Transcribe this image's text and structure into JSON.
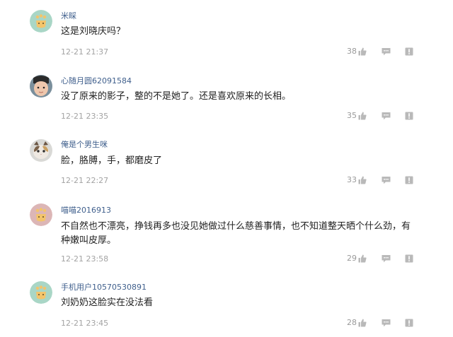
{
  "comments": [
    {
      "username": "米睬",
      "text": "这是刘晓庆吗？",
      "time": "12-21 21:37",
      "likes": "38",
      "avatar_icon": "default-user-avatar-icon"
    },
    {
      "username": "心随月圆62091584",
      "text": "没了原来的影子，整的不是她了。还是喜欢原来的长相。",
      "time": "12-21 23:35",
      "likes": "35",
      "avatar_icon": "child-photo-avatar-icon"
    },
    {
      "username": "俺是个男生咪",
      "text": "脸，胳膊，手，都磨皮了",
      "time": "12-21 22:27",
      "likes": "33",
      "avatar_icon": "kitten-photo-avatar-icon"
    },
    {
      "username": "喵喵2016913",
      "text": "不自然也不漂亮，挣钱再多也没见她做过什么慈善事情，也不知道整天晒个什么劲，有种嫩叫皮厚。",
      "time": "12-21 23:58",
      "likes": "29",
      "avatar_icon": "default-user-avatar-pink-icon"
    },
    {
      "username": "手机用户10570530891",
      "text": "刘奶奶这脸实在没法看",
      "time": "12-21 23:45",
      "likes": "28",
      "avatar_icon": "default-user-avatar-icon"
    }
  ],
  "icons": {
    "like": "thumbs-up-icon",
    "reply": "reply-bubble-icon",
    "report": "report-flag-icon"
  },
  "colors": {
    "username": "#3f5f8c",
    "text": "#222222",
    "meta": "#a3a3a3",
    "icon": "#b9b9b9"
  }
}
